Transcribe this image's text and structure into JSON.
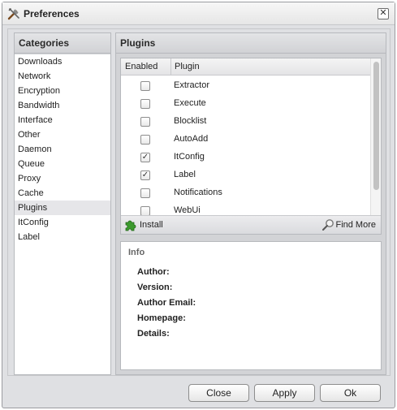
{
  "window": {
    "title": "Preferences"
  },
  "categories": {
    "header": "Categories",
    "items": [
      {
        "label": "Downloads"
      },
      {
        "label": "Network"
      },
      {
        "label": "Encryption"
      },
      {
        "label": "Bandwidth"
      },
      {
        "label": "Interface"
      },
      {
        "label": "Other"
      },
      {
        "label": "Daemon"
      },
      {
        "label": "Queue"
      },
      {
        "label": "Proxy"
      },
      {
        "label": "Cache"
      },
      {
        "label": "Plugins",
        "selected": true
      },
      {
        "label": "ItConfig"
      },
      {
        "label": "Label"
      }
    ]
  },
  "plugins": {
    "header": "Plugins",
    "columns": {
      "enabled": "Enabled",
      "plugin": "Plugin"
    },
    "rows": [
      {
        "name": "Extractor",
        "enabled": false
      },
      {
        "name": "Execute",
        "enabled": false
      },
      {
        "name": "Blocklist",
        "enabled": false
      },
      {
        "name": "AutoAdd",
        "enabled": false
      },
      {
        "name": "ItConfig",
        "enabled": true
      },
      {
        "name": "Label",
        "enabled": true
      },
      {
        "name": "Notifications",
        "enabled": false
      },
      {
        "name": "WebUi",
        "enabled": false
      }
    ],
    "install_label": "Install",
    "find_more_label": "Find More"
  },
  "info": {
    "title": "Info",
    "author_label": "Author:",
    "version_label": "Version:",
    "email_label": "Author Email:",
    "homepage_label": "Homepage:",
    "details_label": "Details:"
  },
  "buttons": {
    "close": "Close",
    "apply": "Apply",
    "ok": "Ok"
  },
  "icons": {
    "title": "tools-icon",
    "install": "puzzle-icon",
    "find_more": "magnifier-icon",
    "close": "close-icon"
  },
  "check_glyph": "✓"
}
